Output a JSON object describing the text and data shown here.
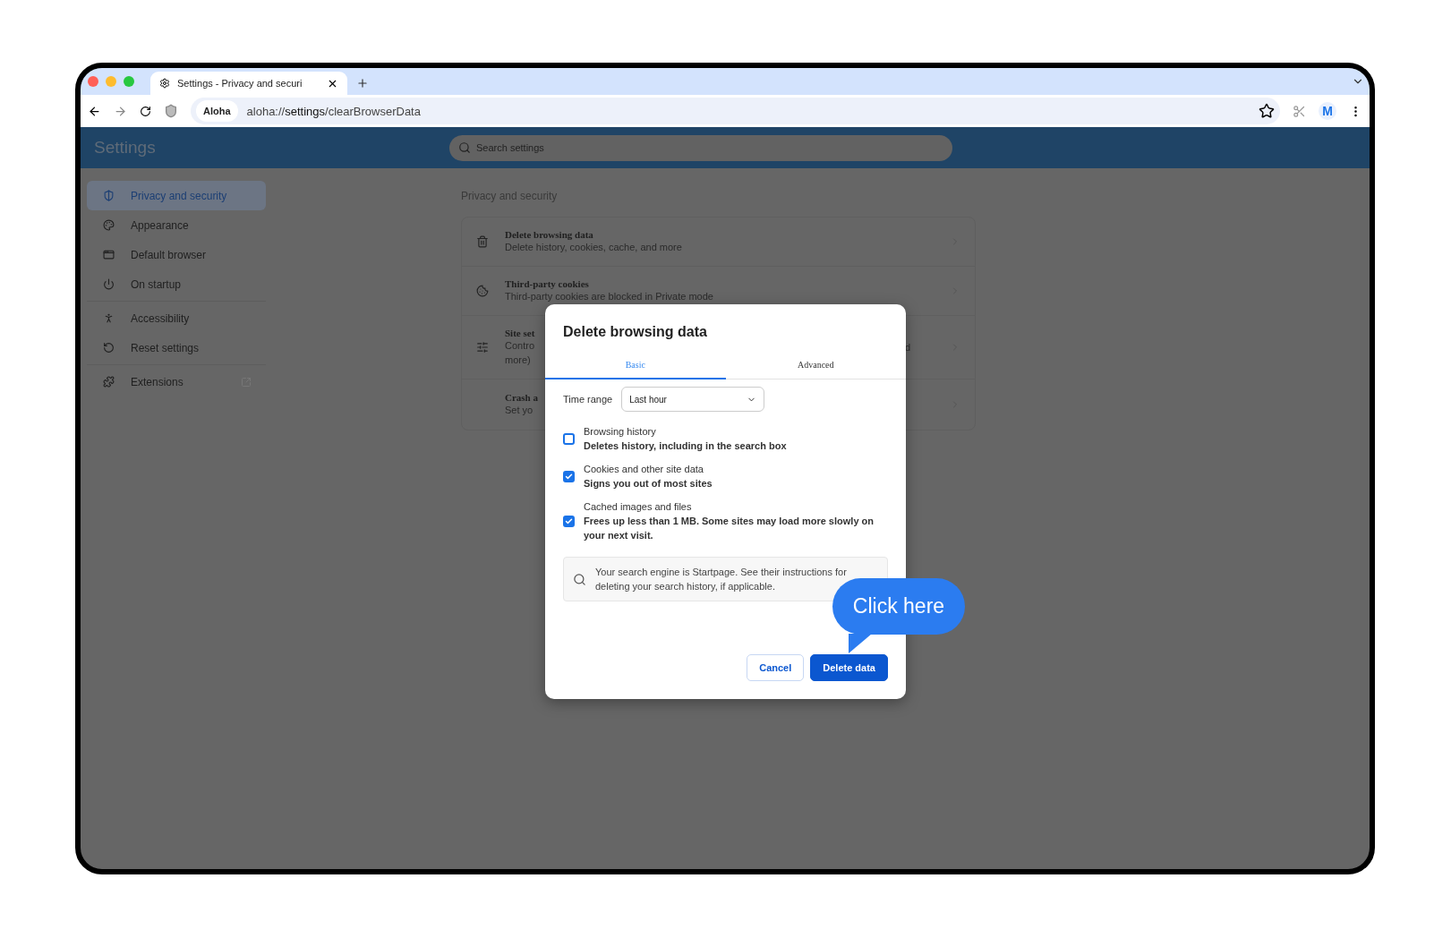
{
  "browser": {
    "tab_title": "Settings - Privacy and securi",
    "chip": "Aloha",
    "url": "aloha://**settings**/clearBrowserData",
    "avatar": "M"
  },
  "header": {
    "title": "Settings",
    "search_placeholder": "Search settings"
  },
  "sidebar": {
    "groups": [
      {
        "items": [
          {
            "label": "Privacy and security",
            "selected": true,
            "external": false
          },
          {
            "label": "Appearance",
            "selected": false,
            "external": false
          },
          {
            "label": "Default browser",
            "selected": false,
            "external": false
          },
          {
            "label": "On startup",
            "selected": false,
            "external": false
          }
        ]
      },
      {
        "items": [
          {
            "label": "Accessibility",
            "selected": false,
            "external": false
          },
          {
            "label": "Reset settings",
            "selected": false,
            "external": false
          }
        ]
      },
      {
        "items": [
          {
            "label": "Extensions",
            "selected": false,
            "external": true
          }
        ]
      }
    ]
  },
  "section": {
    "heading": "Privacy and security",
    "rows": [
      {
        "title": "Delete browsing data",
        "lines": [
          "Delete history, cookies, cache, and more"
        ]
      },
      {
        "title": "Third-party cookies",
        "lines": [
          "Third-party cookies are blocked in Private mode"
        ]
      },
      {
        "title": "Site set",
        "lines": [
          "Contro",
          "more)"
        ],
        "tail": "d"
      },
      {
        "title": "Crash a",
        "lines": [
          "Set yo"
        ]
      }
    ]
  },
  "dialog": {
    "title": "Delete browsing data",
    "tabs": [
      {
        "label": "Basic",
        "selected": true
      },
      {
        "label": "Advanced",
        "selected": false
      }
    ],
    "time_range": {
      "label": "Time range",
      "value": "Last hour"
    },
    "options": [
      {
        "title": "Browsing history",
        "description": "Deletes history, including in the search box",
        "checked": false
      },
      {
        "title": "Cookies and other site data",
        "description": "Signs you out of most sites",
        "checked": true
      },
      {
        "title": "Cached images and files",
        "description": "Frees up less than 1 MB. Some sites may load more slowly on your next visit.",
        "checked": true
      }
    ],
    "info": "Your search engine is Startpage. See their instructions for deleting your search history, if applicable.",
    "buttons": [
      {
        "label": "Cancel",
        "kind": "secondary"
      },
      {
        "label": "Delete data",
        "kind": "primary"
      }
    ]
  },
  "callout": {
    "text": "Click here"
  }
}
